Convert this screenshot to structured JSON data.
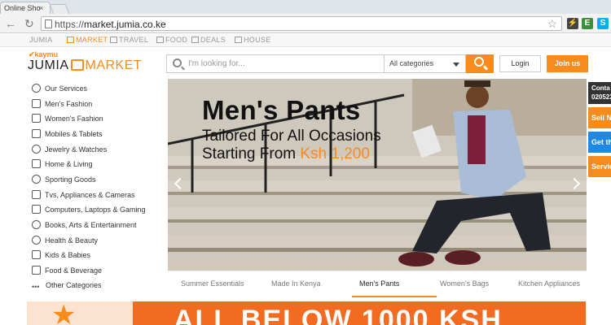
{
  "browser": {
    "tab_title": "Online Sho",
    "tab_close": "×",
    "url_scheme": "https://",
    "url_host": "market.jumia.co.ke"
  },
  "site_nav": {
    "items": [
      {
        "label": "JUMIA"
      },
      {
        "label": "MARKET"
      },
      {
        "label": "TRAVEL"
      },
      {
        "label": "FOOD"
      },
      {
        "label": "DEALS"
      },
      {
        "label": "HOUSE"
      }
    ]
  },
  "header": {
    "logo_top": "kaymu",
    "logo_left": "JUMIA",
    "logo_right": "MARKET",
    "search_placeholder": "I'm looking for...",
    "category_selected": "All categories",
    "login_label": "Login",
    "join_label": "Join us"
  },
  "sidebar": {
    "items": [
      {
        "label": "Our Services",
        "icon": "star-badge-icon"
      },
      {
        "label": "Men's Fashion",
        "icon": "shirt-icon"
      },
      {
        "label": "Women's Fashion",
        "icon": "dress-icon"
      },
      {
        "label": "Mobiles & Tablets",
        "icon": "phone-icon"
      },
      {
        "label": "Jewelry & Watches",
        "icon": "watch-icon"
      },
      {
        "label": "Home & Living",
        "icon": "home-icon"
      },
      {
        "label": "Sporting Goods",
        "icon": "ball-icon"
      },
      {
        "label": "Tvs, Appliances & Cameras",
        "icon": "tv-icon"
      },
      {
        "label": "Computers, Laptops & Gaming",
        "icon": "laptop-icon"
      },
      {
        "label": "Books, Arts & Entertainment",
        "icon": "mask-icon"
      },
      {
        "label": "Health & Beauty",
        "icon": "perfume-icon"
      },
      {
        "label": "Kids & Babies",
        "icon": "baby-icon"
      },
      {
        "label": "Food & Beverage",
        "icon": "food-icon"
      },
      {
        "label": "Other Categories",
        "icon": "dots-icon"
      }
    ]
  },
  "banner": {
    "title": "Men's Pants",
    "subtitle": "Tailored For All Occasions",
    "price_prefix": "Starting From ",
    "price": "Ksh 1,200"
  },
  "banner_tabs": {
    "items": [
      {
        "label": "Summer Essentials"
      },
      {
        "label": "Made In Kenya"
      },
      {
        "label": "Men's Pants",
        "active": true
      },
      {
        "label": "Women's Bags"
      },
      {
        "label": "Kitchen Appliances"
      }
    ]
  },
  "right_panel": {
    "contact_line1": "Conta",
    "contact_line2": "020523",
    "sell": "Sell N",
    "get": "Get th",
    "services": "Servic"
  },
  "promo": {
    "text": "ALL BELOW 1000 KSH"
  },
  "colors": {
    "accent": "#f68b1e",
    "blue": "#1e88e5"
  }
}
